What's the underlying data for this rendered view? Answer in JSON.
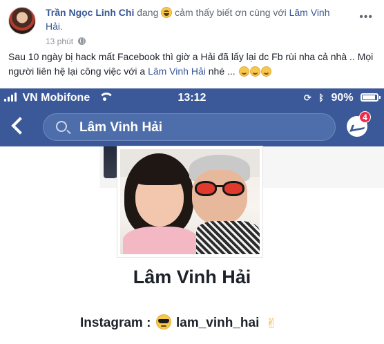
{
  "post": {
    "author": "Trần Ngọc Linh Chi",
    "verb_prefix": "đang",
    "verb_suffix": "cảm thấy biết ơn cùng với",
    "tagged_person": "Lâm Vinh Hải",
    "tagged_suffix": ".",
    "time": "13 phút",
    "privacy_icon": "globe-icon",
    "more_label": "•••",
    "text_part1": "Sau 10 ngày bị hack mất Facebook thì giờ a Hải đã lấy lại dc Fb rùi nha cả nhà .. Mọi người liên hệ lại công việc với a",
    "text_link": "Lâm Vinh Hải",
    "text_part2": "nhé ...",
    "trailing_emojis": [
      "smile-icon",
      "smile-icon",
      "smile-icon"
    ]
  },
  "screenshot": {
    "status_bar": {
      "carrier": "VN Mobifone",
      "time": "13:12",
      "battery": "90%",
      "icons": [
        "signal-icon",
        "wifi-icon",
        "rotation-lock-icon",
        "bluetooth-icon",
        "battery-icon"
      ]
    },
    "nav": {
      "search_value": "Lâm Vinh Hải",
      "messenger_badge": "4"
    },
    "profile": {
      "name": "Lâm Vinh Hải",
      "instagram_label": "Instagram :",
      "instagram_handle": "lam_vinh_hai"
    },
    "colors": {
      "facebook_blue": "#3b5998",
      "link_blue": "#385898",
      "badge_red": "#f02849"
    }
  }
}
